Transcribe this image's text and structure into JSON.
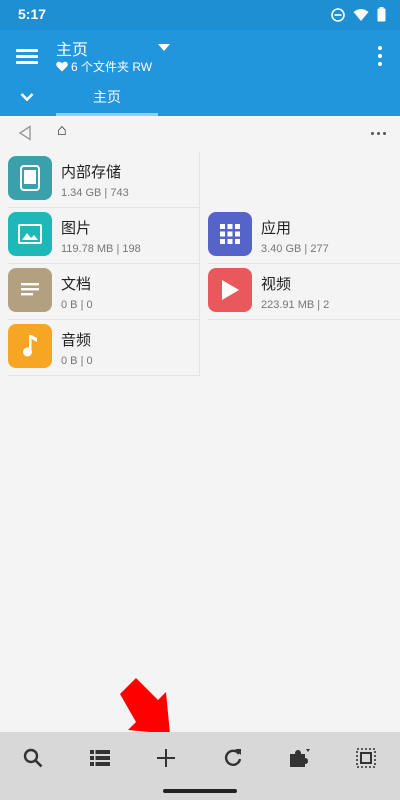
{
  "status_bar": {
    "time": "5:17",
    "icons": [
      "do-not-disturb-icon",
      "wifi-icon",
      "battery-icon"
    ]
  },
  "app_bar": {
    "title": "主页",
    "subtitle": "6 个文件夹 RW",
    "subtitle_icon": "heart-icon"
  },
  "tabs": [
    {
      "label": "主页",
      "active": true
    }
  ],
  "path": {
    "home_symbol": "⌂"
  },
  "folders": [
    {
      "name": "内部存储",
      "meta": "1.34 GB | 743",
      "icon": "phone-icon",
      "color": "#3aa0aa"
    },
    {
      "name": "图片",
      "meta": "119.78 MB | 198",
      "icon": "image-icon",
      "color": "#1fb8b8"
    },
    {
      "name": "应用",
      "meta": "3.40 GB | 277",
      "icon": "apps-grid-icon",
      "color": "#5663c9"
    },
    {
      "name": "文档",
      "meta": "0 B | 0",
      "icon": "document-icon",
      "color": "#b3a080"
    },
    {
      "name": "视频",
      "meta": "223.91 MB | 2",
      "icon": "play-icon",
      "color": "#e9585a"
    },
    {
      "name": "音频",
      "meta": "0 B | 0",
      "icon": "music-note-icon",
      "color": "#f6a623"
    }
  ],
  "bottom_bar": [
    "search-icon",
    "list-view-icon",
    "add-icon",
    "refresh-icon",
    "plugins-icon",
    "select-all-icon"
  ],
  "colors": {
    "primary": "#2196dd",
    "status": "#1f8fd3",
    "tab_indicator": "#7fd8f5",
    "annotation_arrow": "#ff0000"
  }
}
